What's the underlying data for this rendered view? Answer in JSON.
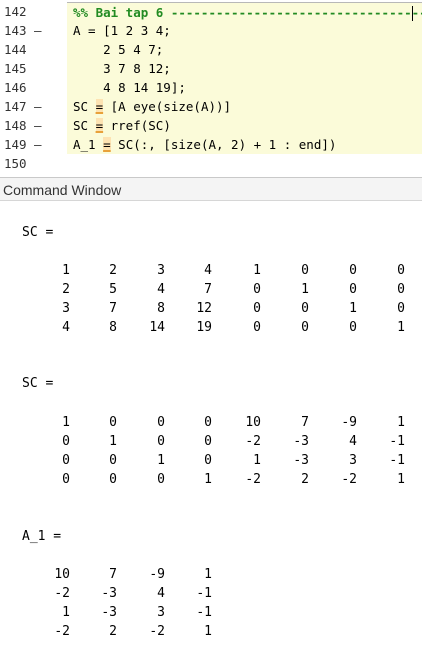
{
  "editor": {
    "lines": [
      {
        "num": "142",
        "dash": "",
        "code": "%% Bai tap 6 -----------------------------------",
        "cell": true,
        "hl": true
      },
      {
        "num": "143",
        "dash": "–",
        "code": "A = [1 2 3 4;",
        "hl": true
      },
      {
        "num": "144",
        "dash": "",
        "code": "    2 5 4 7;",
        "hl": true
      },
      {
        "num": "145",
        "dash": "",
        "code": "    3 7 8 12;",
        "hl": true
      },
      {
        "num": "146",
        "dash": "",
        "code": "    4 8 14 19];",
        "hl": true
      },
      {
        "num": "147",
        "dash": "–",
        "pre": "SC ",
        "u": "=",
        "post": " [A eye(size(A))]",
        "hl": true
      },
      {
        "num": "148",
        "dash": "–",
        "pre": "SC ",
        "u": "=",
        "post": " rref(SC)",
        "hl": true
      },
      {
        "num": "149",
        "dash": "–",
        "pre": "A_1 ",
        "u": "=",
        "post": " SC(:, [size(A, 2) + 1 : end])",
        "hl": true
      },
      {
        "num": "150",
        "dash": "",
        "code": "",
        "hl": false
      }
    ]
  },
  "command_window": {
    "title": "Command Window",
    "outputs": [
      {
        "name": "SC =",
        "rows": [
          [
            "1",
            "2",
            "3",
            "4",
            "1",
            "0",
            "0",
            "0"
          ],
          [
            "2",
            "5",
            "4",
            "7",
            "0",
            "1",
            "0",
            "0"
          ],
          [
            "3",
            "7",
            "8",
            "12",
            "0",
            "0",
            "1",
            "0"
          ],
          [
            "4",
            "8",
            "14",
            "19",
            "0",
            "0",
            "0",
            "1"
          ]
        ]
      },
      {
        "name": "SC =",
        "rows": [
          [
            "1",
            "0",
            "0",
            "0",
            "10",
            "7",
            "-9",
            "1"
          ],
          [
            "0",
            "1",
            "0",
            "0",
            "-2",
            "-3",
            "4",
            "-1"
          ],
          [
            "0",
            "0",
            "1",
            "0",
            "1",
            "-3",
            "3",
            "-1"
          ],
          [
            "0",
            "0",
            "0",
            "1",
            "-2",
            "2",
            "-2",
            "1"
          ]
        ]
      },
      {
        "name": "A_1 =",
        "rows": [
          [
            "10",
            "7",
            "-9",
            "1"
          ],
          [
            "-2",
            "-3",
            "4",
            "-1"
          ],
          [
            "1",
            "-3",
            "3",
            "-1"
          ],
          [
            "-2",
            "2",
            "-2",
            "1"
          ]
        ]
      }
    ]
  }
}
